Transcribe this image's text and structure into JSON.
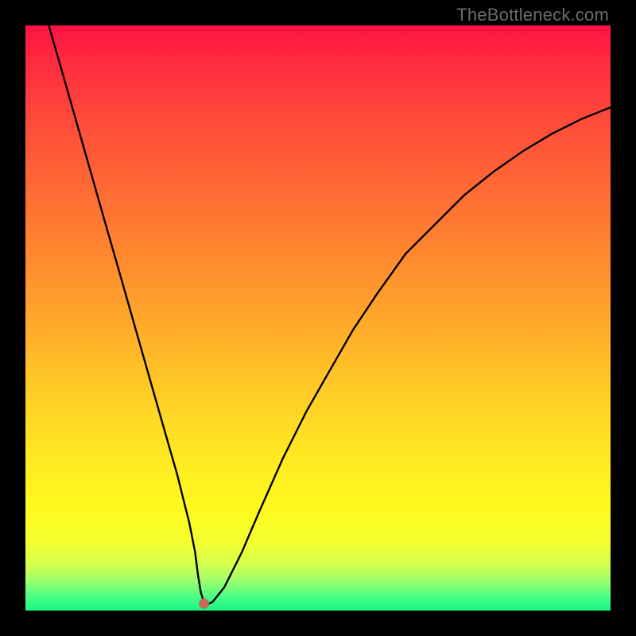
{
  "attribution": "TheBottleneck.com",
  "colors": {
    "page_bg": "#000000",
    "gradient_top": "#ff1244",
    "gradient_mid1": "#ff8a2e",
    "gradient_mid2": "#ffe922",
    "gradient_bottom": "#17f784",
    "curve": "#000000",
    "marker": "#c76a5a"
  },
  "chart_data": {
    "type": "line",
    "title": "",
    "xlabel": "",
    "ylabel": "",
    "xlim": [
      0,
      100
    ],
    "ylim": [
      0,
      100
    ],
    "grid": false,
    "legend": false,
    "series": [
      {
        "name": "curve",
        "x": [
          4,
          6,
          8,
          10,
          12,
          14,
          16,
          18,
          20,
          22,
          24,
          26,
          27,
          28,
          29,
          29.5,
          30,
          30.5,
          31,
          32,
          34,
          37,
          40,
          44,
          48,
          52,
          56,
          60,
          65,
          70,
          75,
          80,
          85,
          90,
          95,
          100
        ],
        "values": [
          100,
          93,
          86,
          79,
          72,
          65,
          58,
          51,
          44,
          37,
          30,
          23,
          19,
          15,
          10,
          6,
          3,
          1.5,
          1,
          1.5,
          4,
          10,
          17,
          26,
          34,
          41,
          48,
          54,
          61,
          66,
          71,
          75,
          78.5,
          81.5,
          84,
          86
        ]
      }
    ],
    "marker": {
      "x": 30.5,
      "y": 1.2
    }
  }
}
